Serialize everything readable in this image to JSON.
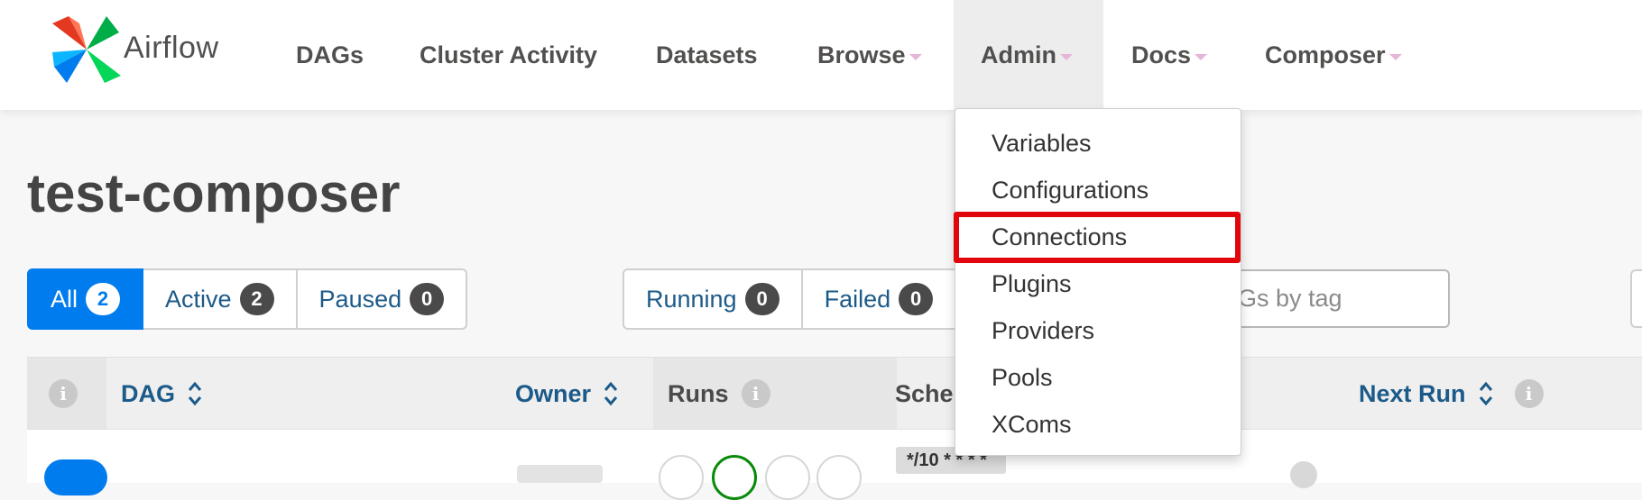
{
  "brand": {
    "name": "Airflow"
  },
  "nav": {
    "dags": "DAGs",
    "cluster_activity": "Cluster Activity",
    "datasets": "Datasets",
    "browse": "Browse",
    "admin": "Admin",
    "docs": "Docs",
    "composer": "Composer"
  },
  "page_title": "test-composer",
  "status_filters": [
    {
      "label": "All",
      "count": "2",
      "active": true
    },
    {
      "label": "Active",
      "count": "2"
    },
    {
      "label": "Paused",
      "count": "0"
    }
  ],
  "run_filters": [
    {
      "label": "Running",
      "count": "0"
    },
    {
      "label": "Failed",
      "count": "0"
    }
  ],
  "tag_search": {
    "placeholder_visible": "Gs by tag"
  },
  "table": {
    "headers": {
      "dag": "DAG",
      "owner": "Owner",
      "runs": "Runs",
      "schedule_partial": "Sche",
      "next_run": "Next Run"
    },
    "row": {
      "schedule": "*/10 * * * *"
    }
  },
  "admin_menu": {
    "items": [
      "Variables",
      "Configurations",
      "Connections",
      "Plugins",
      "Providers",
      "Pools",
      "XComs"
    ],
    "highlighted": "Connections",
    "highlight_color": "#e0060b"
  },
  "colors": {
    "accent": "#017cee",
    "link": "#1c5a89",
    "success": "#0a8a0a",
    "caret": "#e6b6d8"
  }
}
